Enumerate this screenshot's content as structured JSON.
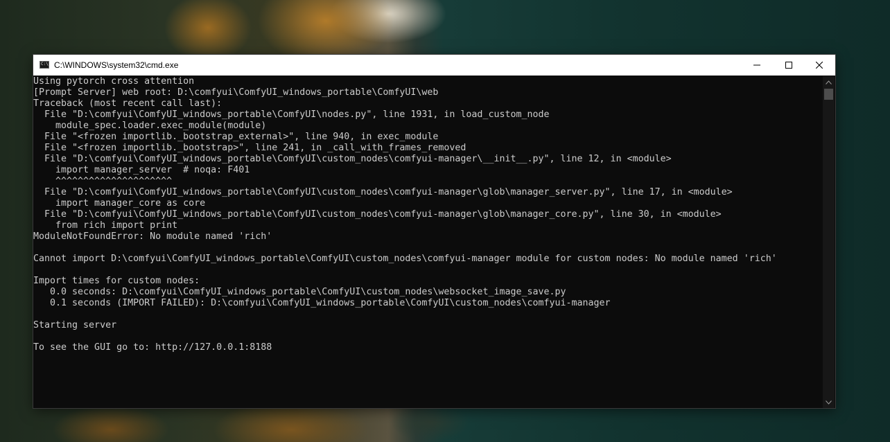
{
  "window": {
    "title": "C:\\WINDOWS\\system32\\cmd.exe",
    "controls": {
      "minimize": "minimize",
      "maximize": "maximize",
      "close": "close"
    }
  },
  "console": {
    "lines": [
      "Using pytorch cross attention",
      "[Prompt Server] web root: D:\\comfyui\\ComfyUI_windows_portable\\ComfyUI\\web",
      "Traceback (most recent call last):",
      "  File \"D:\\comfyui\\ComfyUI_windows_portable\\ComfyUI\\nodes.py\", line 1931, in load_custom_node",
      "    module_spec.loader.exec_module(module)",
      "  File \"<frozen importlib._bootstrap_external>\", line 940, in exec_module",
      "  File \"<frozen importlib._bootstrap>\", line 241, in _call_with_frames_removed",
      "  File \"D:\\comfyui\\ComfyUI_windows_portable\\ComfyUI\\custom_nodes\\comfyui-manager\\__init__.py\", line 12, in <module>",
      "    import manager_server  # noqa: F401",
      "    ^^^^^^^^^^^^^^^^^^^^^",
      "  File \"D:\\comfyui\\ComfyUI_windows_portable\\ComfyUI\\custom_nodes\\comfyui-manager\\glob\\manager_server.py\", line 17, in <module>",
      "    import manager_core as core",
      "  File \"D:\\comfyui\\ComfyUI_windows_portable\\ComfyUI\\custom_nodes\\comfyui-manager\\glob\\manager_core.py\", line 30, in <module>",
      "    from rich import print",
      "ModuleNotFoundError: No module named 'rich'",
      "",
      "Cannot import D:\\comfyui\\ComfyUI_windows_portable\\ComfyUI\\custom_nodes\\comfyui-manager module for custom nodes: No module named 'rich'",
      "",
      "Import times for custom nodes:",
      "   0.0 seconds: D:\\comfyui\\ComfyUI_windows_portable\\ComfyUI\\custom_nodes\\websocket_image_save.py",
      "   0.1 seconds (IMPORT FAILED): D:\\comfyui\\ComfyUI_windows_portable\\ComfyUI\\custom_nodes\\comfyui-manager",
      "",
      "Starting server",
      "",
      "To see the GUI go to: http://127.0.0.1:8188"
    ]
  },
  "colors": {
    "console_bg": "#0c0c0c",
    "console_text": "#cccccc",
    "titlebar_bg": "#ffffff"
  }
}
